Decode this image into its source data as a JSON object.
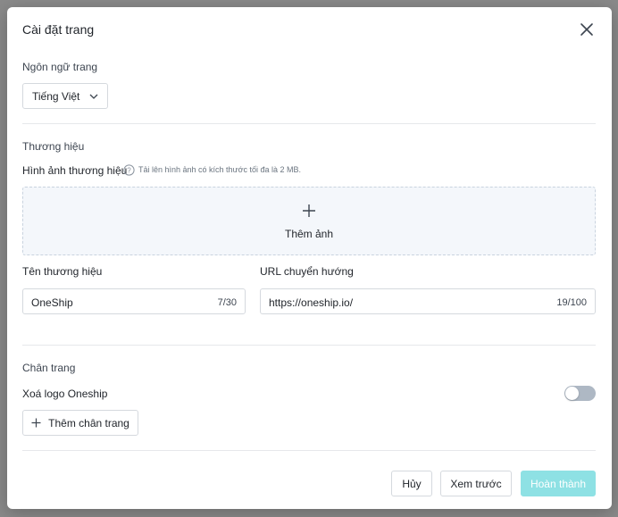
{
  "modal": {
    "title": "Cài đặt trang",
    "close_icon": "close-icon"
  },
  "language": {
    "section_label": "Ngôn ngữ trang",
    "selected": "Tiếng Việt",
    "chevron_icon": "chevron-down-icon"
  },
  "brand": {
    "section_label": "Thương hiệu",
    "image_label": "Hình ảnh thương hiệu",
    "help_icon": "question-circle-icon",
    "image_hint": "Tải lên hình ảnh có kích thước tối đa là 2 MB.",
    "add_image_label": "Thêm ảnh",
    "plus_icon": "plus-icon",
    "name_label": "Tên thương hiệu",
    "name_value": "OneShip",
    "name_count": "7/30",
    "url_label": "URL chuyển hướng",
    "url_value": "https://oneship.io/",
    "url_count": "19/100"
  },
  "footer_section": {
    "section_label": "Chân trang",
    "remove_logo_label": "Xoá logo Oneship",
    "remove_logo_enabled": false,
    "add_footer_label": "Thêm chân trang"
  },
  "actions": {
    "cancel_label": "Hủy",
    "preview_label": "Xem trước",
    "done_label": "Hoàn thành"
  },
  "colors": {
    "primary_disabled": "#8ee1e4",
    "toggle_off": "#aeb8c4",
    "dropzone_bg": "#f4f7fb"
  }
}
